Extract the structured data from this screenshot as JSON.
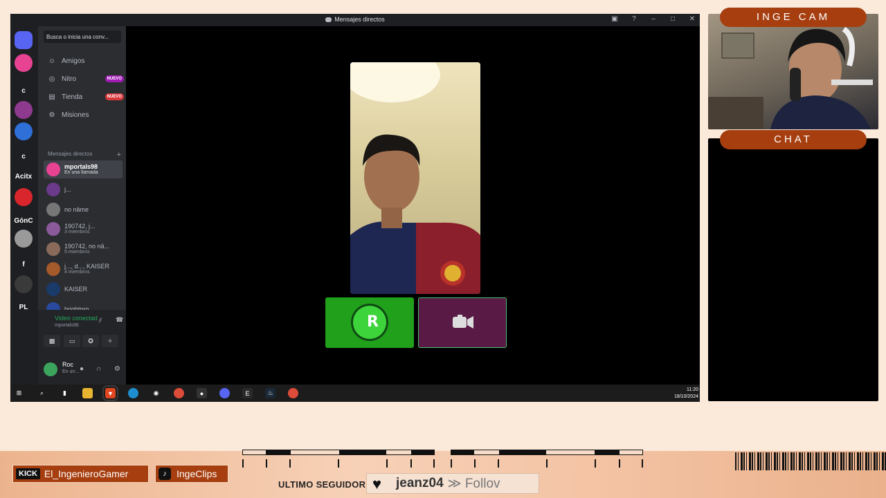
{
  "window": {
    "title": "Mensajes directos"
  },
  "guilds": [
    {
      "label": "",
      "color": "#5865f2",
      "icon": "discord-icon"
    },
    {
      "label": "",
      "color": "#e84393",
      "icon": "discord-icon"
    },
    {
      "label": "c",
      "color": "",
      "icon": ""
    },
    {
      "label": "",
      "color": "#8e3a8f",
      "icon": "server-avatar"
    },
    {
      "label": "",
      "color": "#2e6fd8",
      "icon": "server-avatar"
    },
    {
      "label": "c",
      "color": "",
      "icon": ""
    },
    {
      "label": "Acitx",
      "color": "",
      "icon": ""
    },
    {
      "label": "",
      "color": "#d9262c",
      "icon": "server-avatar"
    },
    {
      "label": "GónC",
      "color": "",
      "icon": ""
    },
    {
      "label": "",
      "color": "#9a9a9a",
      "icon": "server-avatar"
    },
    {
      "label": "f",
      "color": "",
      "icon": ""
    },
    {
      "label": "",
      "color": "#3a3a3a",
      "icon": "server-avatar"
    },
    {
      "label": "PL",
      "color": "",
      "icon": ""
    }
  ],
  "sidebar": {
    "search_placeholder": "Busca o inicia una conv...",
    "nav": [
      {
        "label": "Amigos",
        "badge": "",
        "icon": "friends-icon"
      },
      {
        "label": "Nitro",
        "badge": "NUEVO",
        "icon": "nitro-icon"
      },
      {
        "label": "Tienda",
        "badge": "NUEVO",
        "icon": "shop-icon"
      },
      {
        "label": "Misiones",
        "badge": "",
        "icon": "quests-icon"
      }
    ],
    "dm_header": "Mensajes directos",
    "dms": [
      {
        "name": "mportals98",
        "sub": "En una llamada",
        "color": "#e84393"
      },
      {
        "name": "j...",
        "sub": "",
        "color": "#6b3a8a"
      },
      {
        "name": "no nâme",
        "sub": "",
        "color": "#777777"
      },
      {
        "name": "190742, j...",
        "sub": "3 miembros",
        "color": "#8a5a9a"
      },
      {
        "name": "190742, no nâ...",
        "sub": "5 miembros",
        "color": "#8a6a5a"
      },
      {
        "name": "j..., d..., KAISER",
        "sub": "4 miembros",
        "color": "#a45a2a"
      },
      {
        "name": "KAISER",
        "sub": "",
        "color": "#1a3a6a"
      },
      {
        "name": "brightpro",
        "sub": "",
        "color": "#2a4aa0"
      }
    ]
  },
  "voice": {
    "status": "Video conectad",
    "channel": "mportals98"
  },
  "user": {
    "name": "Roc",
    "status": "En un..."
  },
  "taskbar": {
    "time": "11:20",
    "date": "18/10/2024"
  },
  "overlay": {
    "cam_label": "INGE CAM",
    "chat_label": "CHAT",
    "kick_badge": "KICK",
    "kick_user": "El_IngenieroGamer",
    "tiktok_user": "IngeClips",
    "ultimo_label": "ULTIMO SEGUIDOR",
    "follower": "jeanz04",
    "follow_tail": "≫ Follov"
  }
}
